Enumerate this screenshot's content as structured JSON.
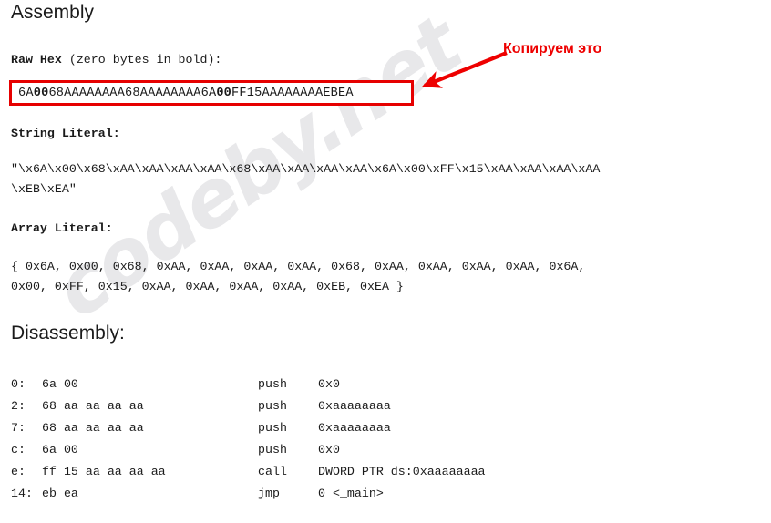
{
  "document": {
    "title": "Assembly",
    "watermark": "codeby.net"
  },
  "sections": {
    "assembly_heading": "Assembly",
    "disassembly_heading": "Disassembly:",
    "raw_hex_label_bold": "Raw Hex",
    "raw_hex_label_rest": " (zero bytes in bold):",
    "string_literal_label": "String Literal:",
    "array_literal_label": "Array Literal:"
  },
  "raw_hex": {
    "full_value": "6A0068AAAAAAAA68AAAAAAAA6A00FF15AAAAAAAAEBEA",
    "segments": [
      {
        "text": "6A",
        "bold": false
      },
      {
        "text": "00",
        "bold": true
      },
      {
        "text": "68AAAAAAAA68AAAAAAAA6A",
        "bold": false
      },
      {
        "text": "00",
        "bold": true
      },
      {
        "text": "FF15AAAAAAAAEBEA",
        "bold": false
      }
    ]
  },
  "string_literal": {
    "line1": "\"\\x6A\\x00\\x68\\xAA\\xAA\\xAA\\xAA\\x68\\xAA\\xAA\\xAA\\xAA\\x6A\\x00\\xFF\\x15\\xAA\\xAA\\xAA\\xAA",
    "line2": "\\xEB\\xEA\""
  },
  "array_literal": {
    "line1": "{ 0x6A, 0x00, 0x68, 0xAA, 0xAA, 0xAA, 0xAA, 0x68, 0xAA, 0xAA, 0xAA, 0xAA, 0x6A,",
    "line2": "0x00, 0xFF, 0x15, 0xAA, 0xAA, 0xAA, 0xAA, 0xEB, 0xEA }"
  },
  "disassembly": {
    "rows": [
      {
        "address": "0:",
        "bytes": "6a 00",
        "mnemonic": "push",
        "operands": "0x0"
      },
      {
        "address": "2:",
        "bytes": "68 aa aa aa aa",
        "mnemonic": "push",
        "operands": "0xaaaaaaaa"
      },
      {
        "address": "7:",
        "bytes": "68 aa aa aa aa",
        "mnemonic": "push",
        "operands": "0xaaaaaaaa"
      },
      {
        "address": "c:",
        "bytes": "6a 00",
        "mnemonic": "push",
        "operands": "0x0"
      },
      {
        "address": "e:",
        "bytes": "ff 15 aa aa aa aa",
        "mnemonic": "call",
        "operands": "DWORD PTR ds:0xaaaaaaaa"
      },
      {
        "address": "14:",
        "bytes": "eb ea",
        "mnemonic": "jmp",
        "operands": "0 <_main>"
      }
    ]
  },
  "annotation": {
    "text": "Копируем это",
    "color": "#ee0000",
    "arrow_color": "#ee0000",
    "points_to": "raw-hex-box"
  },
  "colors": {
    "highlight_box_border": "#e60000",
    "annotation_red": "#ee0000",
    "text": "#1a1a1a",
    "watermark_gray": "#e8e8ea",
    "background": "#ffffff"
  }
}
